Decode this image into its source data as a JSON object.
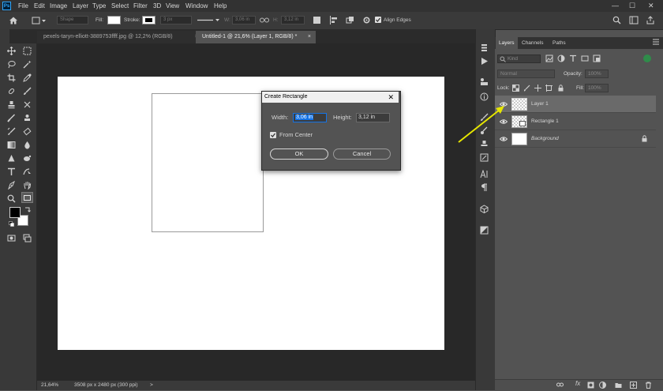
{
  "app": {
    "logo": "Ps"
  },
  "menu": {
    "items": [
      "File",
      "Edit",
      "Image",
      "Layer",
      "Type",
      "Select",
      "Filter",
      "3D",
      "View",
      "Window",
      "Help"
    ]
  },
  "window_controls": {
    "minimize": "—",
    "maximize": "☐",
    "close": "✕"
  },
  "options_bar": {
    "shape_mode": "Shape",
    "fill_label": "Fill:",
    "stroke_label": "Stroke:",
    "stroke_width": "3 px",
    "w_label": "W:",
    "w_value": "3,06 in",
    "h_label": "H:",
    "h_value": "3,12 in",
    "align_edges_label": "Align Edges"
  },
  "tabs": [
    {
      "label": "pexels-taryn-elliott-3889753ffff.jpg @ 12,2% (RGB/8)",
      "active": false
    },
    {
      "label": "Untitled-1 @ 21,6% (Layer 1, RGB/8) *",
      "active": true
    }
  ],
  "tab_close": "×",
  "status": {
    "zoom": "21,64%",
    "doc_info": "3508 px x 2480 px (300 ppi)",
    "arrow": ">"
  },
  "dialog": {
    "title": "Create Rectangle",
    "close": "✕",
    "width_label": "Width:",
    "width_value": "3,06 in",
    "height_label": "Height:",
    "height_value": "3,12 in",
    "from_center_label": "From Center",
    "from_center_checked": true,
    "ok_label": "OK",
    "cancel_label": "Cancel"
  },
  "layers_panel": {
    "tabs": [
      "Layers",
      "Channels",
      "Paths"
    ],
    "filter_placeholder": "Kind",
    "blend_mode": "Normal",
    "opacity_label": "Opacity:",
    "opacity_value": "100%",
    "lock_label": "Lock:",
    "fill_label": "Fill:",
    "fill_value": "100%",
    "layers": [
      {
        "name": "Layer 1",
        "selected": true,
        "italic": false,
        "locked": false
      },
      {
        "name": "Rectangle 1",
        "selected": false,
        "italic": false,
        "locked": false
      },
      {
        "name": "Background",
        "selected": false,
        "italic": true,
        "locked": true
      }
    ],
    "footer_fx": "fx"
  },
  "colors": {
    "accent": "#1473e6",
    "annotation_arrow": "#e6e600",
    "foreground_swatch": "#000000",
    "background_swatch": "#ffffff"
  }
}
